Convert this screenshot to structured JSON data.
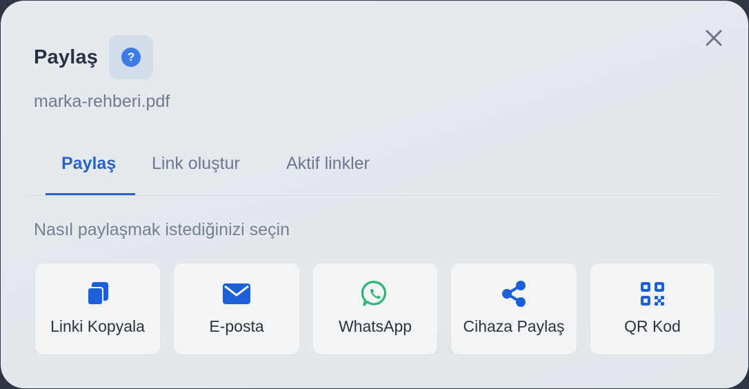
{
  "dialog": {
    "title": "Paylaş",
    "help_icon_glyph": "?",
    "filename": "marka-rehberi.pdf",
    "close_icon": "close-icon"
  },
  "tabs": [
    {
      "label": "Paylaş",
      "active": true
    },
    {
      "label": "Link oluştur",
      "active": false
    },
    {
      "label": "Aktif linkler",
      "active": false
    }
  ],
  "instruction": "Nasıl paylaşmak istediğinizi seçin",
  "options": [
    {
      "label": "Linki Kopyala",
      "icon": "copy-icon"
    },
    {
      "label": "E-posta",
      "icon": "mail-icon"
    },
    {
      "label": "WhatsApp",
      "icon": "whatsapp-icon"
    },
    {
      "label": "Cihaza Paylaş",
      "icon": "share-icon"
    },
    {
      "label": "QR Kod",
      "icon": "qr-code-icon"
    }
  ],
  "colors": {
    "accent": "#2b62c8",
    "icon_blue": "#1d5fd6",
    "whatsapp_green": "#2bb673"
  }
}
